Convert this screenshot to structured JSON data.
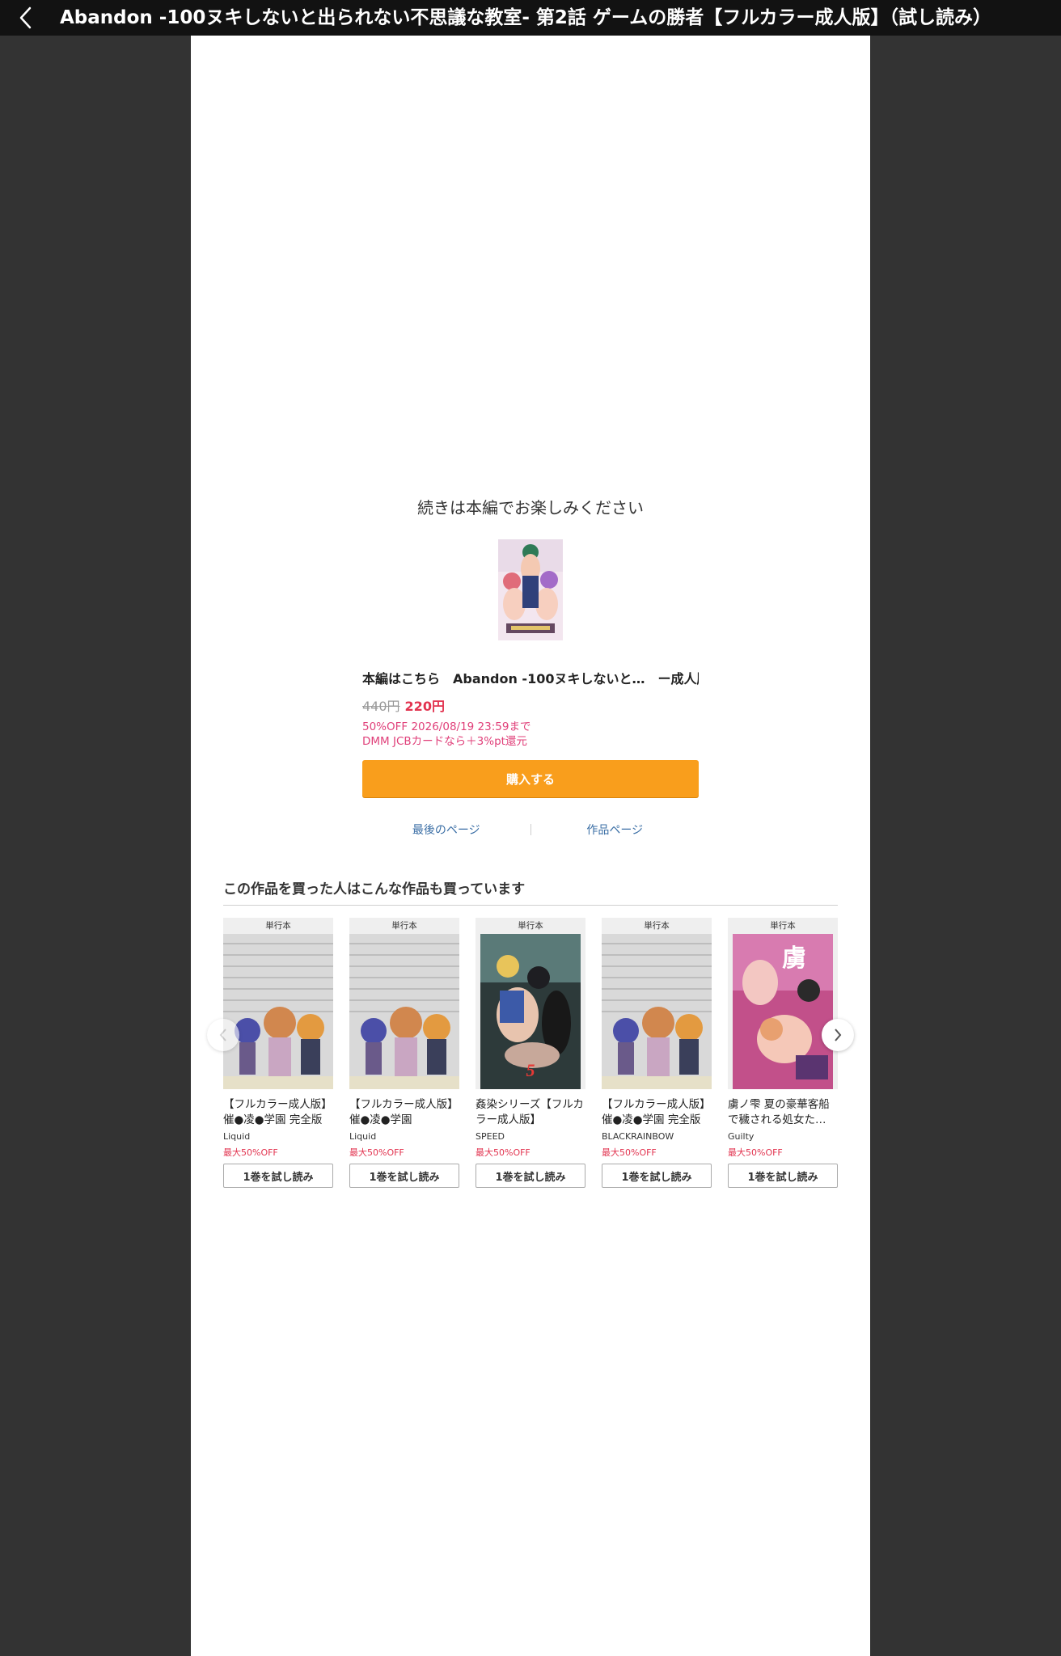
{
  "header": {
    "title": "Abandon -100ヌキしないと出られない不思議な教室- 第2話 ゲームの勝者【フルカラー成人版】（試し読み）"
  },
  "main": {
    "continue_message": "続きは本編でお楽しみください",
    "main_work_link": "本編はこちら　Abandon -100ヌキしないと…　ー成人版】",
    "price_original": "440円",
    "price_sale": "220円",
    "sale_line1": "50%OFF 2026/08/19 23:59まで",
    "sale_line2": "DMM JCBカードなら＋3%pt還元",
    "buy_label": "購入する",
    "last_page_link": "最後のページ",
    "work_page_link": "作品ページ"
  },
  "recommend": {
    "title": "この作品を買った人はこんな作品も買っています",
    "items": [
      {
        "label": "単行本",
        "title": "【フルカラー成人版】催●凌●学園 完全版",
        "author": "Liquid",
        "discount": "最大50%OFF",
        "button": "1巻を試し読み"
      },
      {
        "label": "単行本",
        "title": "【フルカラー成人版】催●凌●学園",
        "author": "Liquid",
        "discount": "最大50%OFF",
        "button": "1巻を試し読み"
      },
      {
        "label": "単行本",
        "title": "姦染シリーズ【フルカラー成人版】",
        "author": "SPEED",
        "discount": "最大50%OFF",
        "button": "1巻を試し読み"
      },
      {
        "label": "単行本",
        "title": "【フルカラー成人版】催●凌●学園 完全版",
        "author": "BLACKRAINBOW",
        "discount": "最大50%OFF",
        "button": "1巻を試し読み"
      },
      {
        "label": "単行本",
        "title": "虜ノ雫 夏の豪華客船で穢される処女た…",
        "author": "Guilty",
        "discount": "最大50%OFF",
        "button": "1巻を試し読み"
      }
    ]
  },
  "colors": {
    "background": "#333333",
    "accent_orange": "#f99e1c",
    "sale_red": "#e2334f",
    "link_blue": "#3a6ea5"
  },
  "icons": {
    "back": "chevron-left-icon",
    "prev": "chevron-left-icon",
    "next": "chevron-right-icon"
  }
}
